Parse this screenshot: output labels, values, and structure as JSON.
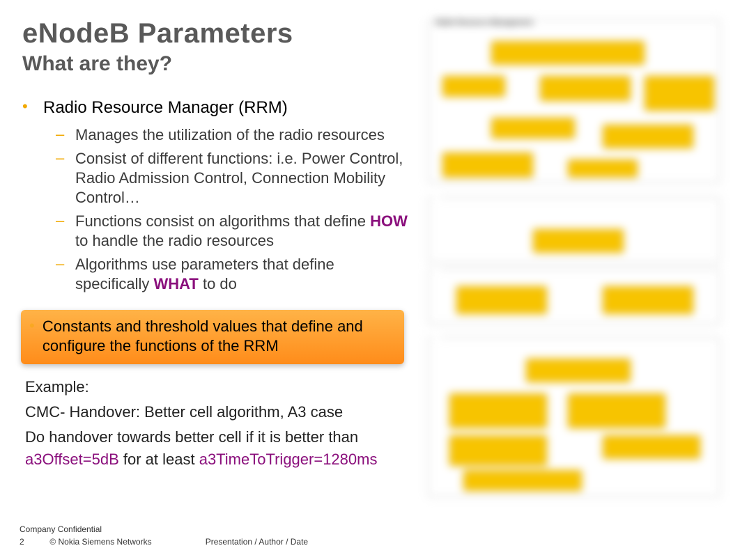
{
  "heading": {
    "title": "eNodeB Parameters",
    "subtitle": "What are they?"
  },
  "bullets": {
    "main": "Radio Resource Manager (RRM)",
    "sub1": "Manages the utilization of the radio resources",
    "sub2": "Consist of different functions: i.e. Power Control, Radio Admission Control, Connection Mobility Control…",
    "sub3_a": "Functions consist on algorithms that define ",
    "sub3_how": "HOW",
    "sub3_b": " to handle the radio resources",
    "sub4_a": "Algorithms use parameters that define specifically ",
    "sub4_what": "WHAT",
    "sub4_b": " to do"
  },
  "highlight": "Constants and threshold values that define and configure the functions of the RRM",
  "example": {
    "label": "Example:",
    "line1": "CMC- Handover: Better cell algorithm, A3 case",
    "line2_a": "Do handover towards better cell if it is better than ",
    "param1": "a3Offset=5dB",
    "line2_b": " for at least ",
    "param2": "a3TimeToTrigger=1280ms"
  },
  "footer": {
    "confidential": "Company Confidential",
    "page": "2",
    "copyright": "© Nokia Siemens Networks",
    "meta": "Presentation / Author / Date"
  }
}
